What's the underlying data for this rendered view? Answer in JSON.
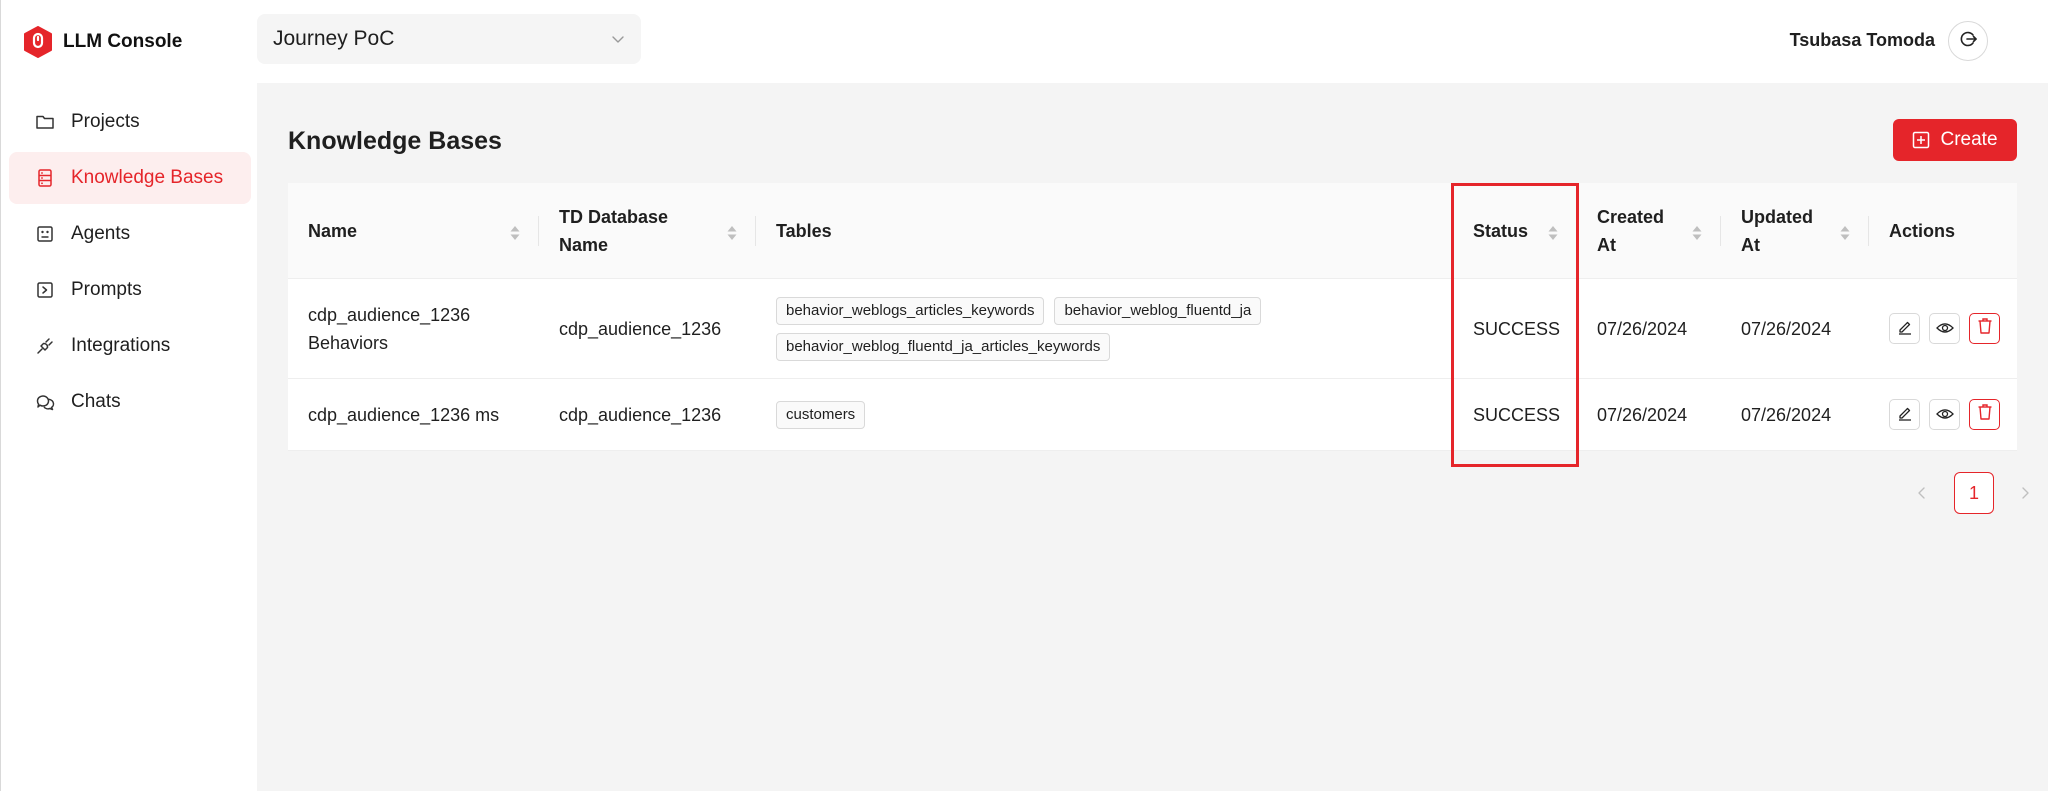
{
  "app": {
    "name": "LLM Console",
    "brand_color": "#e5252a"
  },
  "sidebar": {
    "items": [
      {
        "label": "Projects",
        "icon": "folder-icon",
        "active": false
      },
      {
        "label": "Knowledge Bases",
        "icon": "database-icon",
        "active": true
      },
      {
        "label": "Agents",
        "icon": "robot-icon",
        "active": false
      },
      {
        "label": "Prompts",
        "icon": "prompt-icon",
        "active": false
      },
      {
        "label": "Integrations",
        "icon": "integration-icon",
        "active": false
      },
      {
        "label": "Chats",
        "icon": "chat-icon",
        "active": false
      }
    ]
  },
  "header": {
    "project_select": {
      "value": "Journey PoC"
    },
    "user": {
      "name": "Tsubasa Tomoda"
    }
  },
  "page": {
    "title": "Knowledge Bases",
    "create_label": "Create"
  },
  "table": {
    "columns": [
      {
        "label": "Name",
        "sortable": true
      },
      {
        "label": "TD Database Name",
        "sortable": true
      },
      {
        "label": "Tables",
        "sortable": false
      },
      {
        "label": "Status",
        "sortable": true
      },
      {
        "label": "Created At",
        "sortable": true
      },
      {
        "label": "Updated At",
        "sortable": true
      },
      {
        "label": "Actions",
        "sortable": false
      }
    ],
    "rows": [
      {
        "name": "cdp_audience_1236 Behaviors",
        "database": "cdp_audience_1236",
        "tables": [
          "behavior_weblogs_articles_keywords",
          "behavior_weblog_fluentd_ja",
          "behavior_weblog_fluentd_ja_articles_keywords"
        ],
        "status": "SUCCESS",
        "created_at": "07/26/2024",
        "updated_at": "07/26/2024"
      },
      {
        "name": "cdp_audience_1236 ms",
        "database": "cdp_audience_1236",
        "tables": [
          "customers"
        ],
        "status": "SUCCESS",
        "created_at": "07/26/2024",
        "updated_at": "07/26/2024"
      }
    ]
  },
  "pagination": {
    "current_page": "1"
  }
}
